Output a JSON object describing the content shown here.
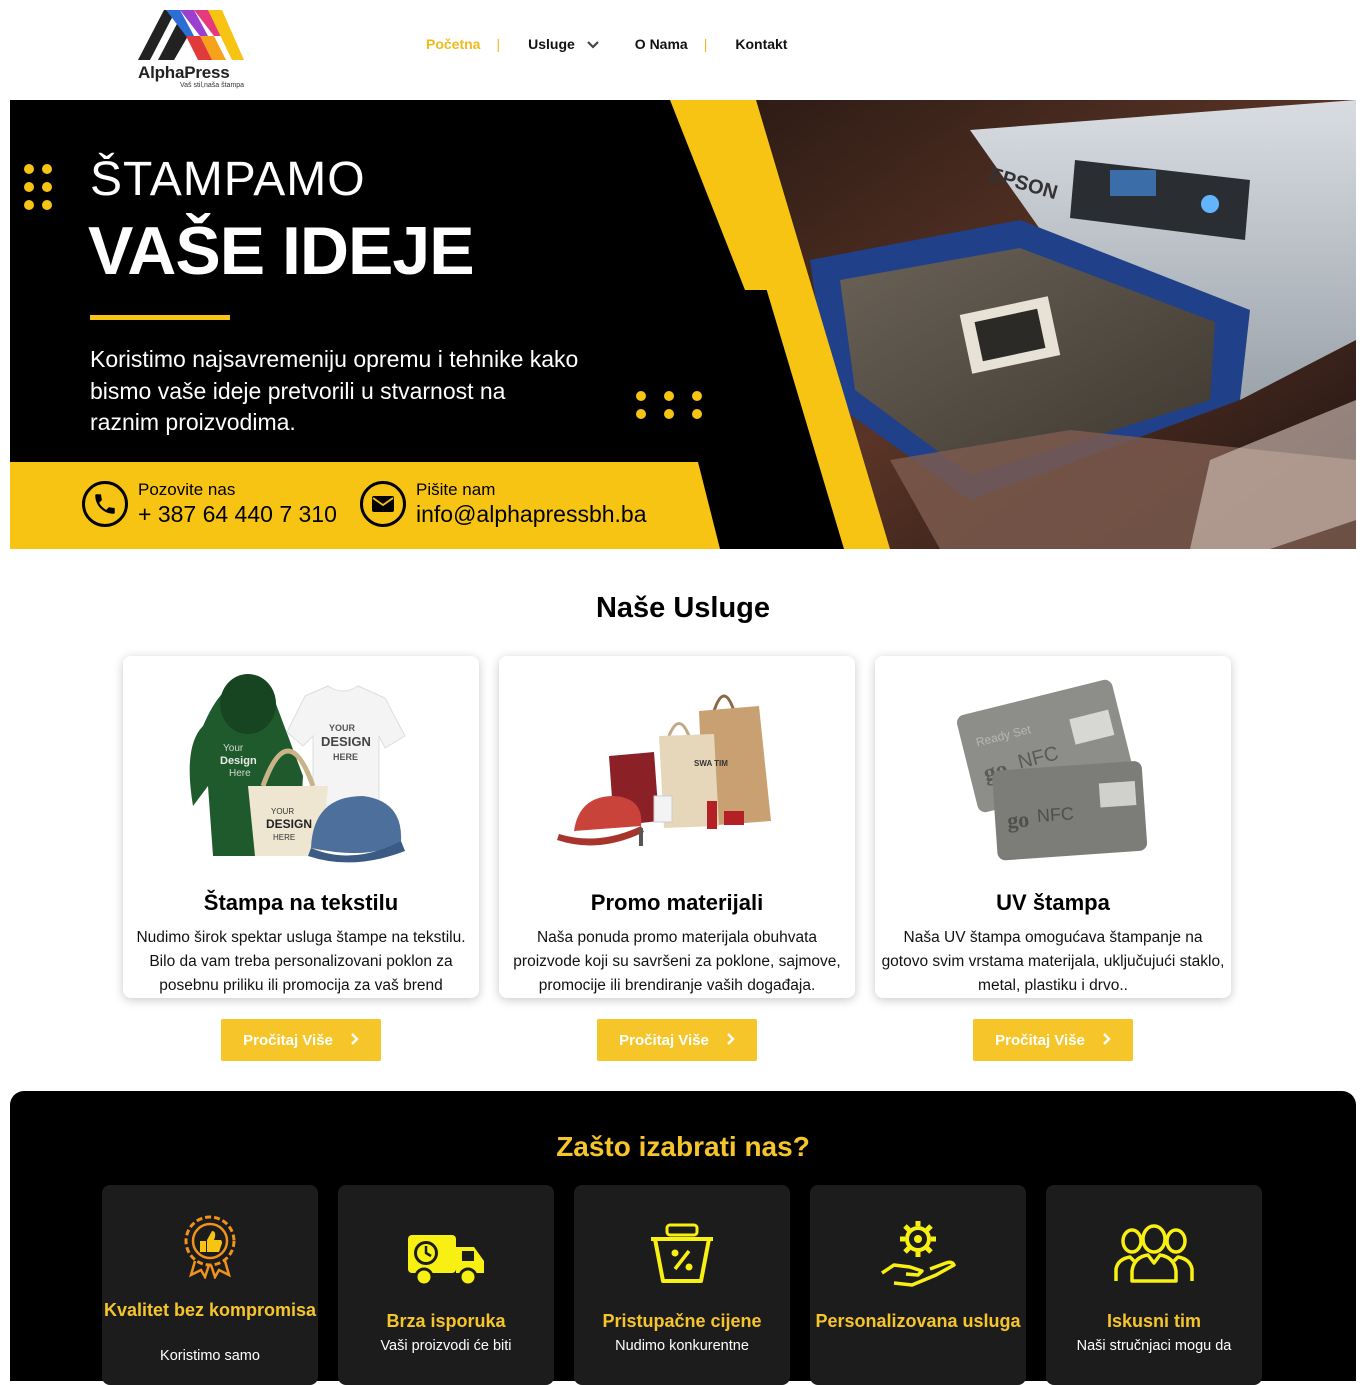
{
  "header": {
    "logo_name": "AlphaPress",
    "logo_tagline": "Vaš stil,naša štampa",
    "nav": [
      "Početna",
      "Usluge",
      "O Nama",
      "Kontakt"
    ],
    "nav_separator": "|"
  },
  "hero": {
    "line1": "ŠTAMPAMO",
    "line2": "VAŠE IDEJE",
    "description": "Koristimo najsavremeniju opremu i tehnike kako bismo vaše ideje pretvorili u stvarnost na raznim proizvodima.",
    "printer_brand": "EPSON",
    "phone_label": "Pozovite nas",
    "phone_value": "+ 387 64 440 7 310",
    "email_label": "Pišite nam",
    "email_value": "info@alphapressbh.ba"
  },
  "services": {
    "title": "Naše Usluge",
    "button_label": "Pročitaj Više",
    "cards": [
      {
        "title": "Štampa na tekstilu",
        "text": "Nudimo širok spektar usluga štampe na tekstilu. Bilo da vam treba personalizovani poklon za posebnu priliku ili promocija za vaš brend",
        "image_text": {
          "shirt_a": "YOUR",
          "shirt_b": "DESIGN",
          "shirt_c": "HERE",
          "hoodie_a": "Your",
          "hoodie_b": "Design",
          "hoodie_c": "Here"
        }
      },
      {
        "title": "Promo materijali",
        "text": "Naša ponuda promo materijala obuhvata proizvode koji su savršeni za poklone, sajmove, promocije ili brendiranje vaših događaja."
      },
      {
        "title": "UV štampa",
        "text": "Naša UV štampa omogućava štampanje na gotovo svim vrstama materijala, uključujući staklo, metal, plastiku i drvo..",
        "image_text": {
          "card_brand": "NFC",
          "card_go": "go",
          "card_ready": "Ready Set"
        }
      }
    ]
  },
  "why": {
    "title": "Zašto izabrati nas?",
    "features": [
      {
        "title": "Kvalitet bez kompromisa",
        "text": "Koristimo samo",
        "icon": "thumbs-up-badge-icon"
      },
      {
        "title": "Brza isporuka",
        "text": "Vaši proizvodi će biti",
        "icon": "delivery-truck-icon"
      },
      {
        "title": "Pristupačne cijene",
        "text": "Nudimo konkurentne",
        "icon": "discount-basket-icon"
      },
      {
        "title": "Personalizovana usluga",
        "text": "",
        "icon": "gear-hand-icon"
      },
      {
        "title": "Iskusni tim",
        "text": "Naši stručnjaci mogu da",
        "icon": "team-icon"
      }
    ]
  },
  "colors": {
    "accent": "#f5c52a",
    "hero_yellow": "#f7c414",
    "dark": "#000000",
    "card_dark": "#1c1c1c"
  }
}
